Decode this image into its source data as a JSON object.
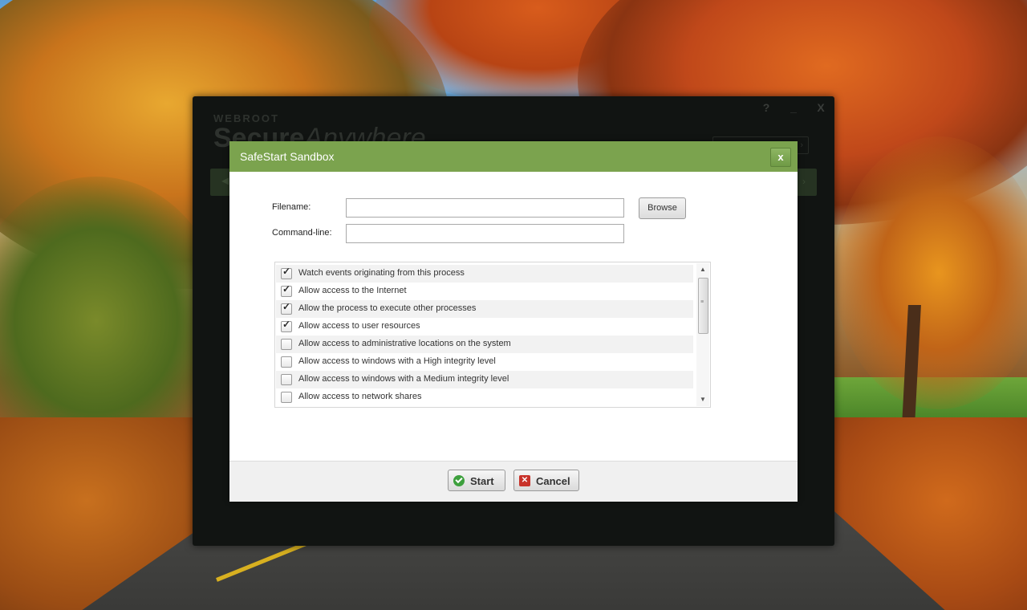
{
  "background_app": {
    "brand_small": "WEBROOT",
    "brand_bold": "Secure",
    "brand_light": "Anywhere",
    "window_controls": [
      "?",
      "_",
      "X"
    ]
  },
  "dialog": {
    "title": "SafeStart Sandbox",
    "close_label": "x",
    "filename_label": "Filename:",
    "filename_value": "",
    "commandline_label": "Command-line:",
    "commandline_value": "",
    "browse_label": "Browse",
    "options": [
      {
        "label": "Watch events originating from this process",
        "checked": true
      },
      {
        "label": "Allow access to the Internet",
        "checked": true
      },
      {
        "label": "Allow the process to execute other processes",
        "checked": true
      },
      {
        "label": "Allow access to user resources",
        "checked": true
      },
      {
        "label": "Allow access to administrative locations on the system",
        "checked": false
      },
      {
        "label": "Allow access to windows with a High integrity level",
        "checked": false
      },
      {
        "label": "Allow access to windows with a Medium integrity level",
        "checked": false
      },
      {
        "label": "Allow access to network shares",
        "checked": false
      }
    ],
    "start_label": "Start",
    "cancel_label": "Cancel"
  },
  "colors": {
    "titlebar": "#7ba34e",
    "app_window": "#111412",
    "start_icon": "#3da03d",
    "cancel_icon": "#c8322a"
  },
  "icons": {
    "close": "close-icon",
    "start": "check-circle-icon",
    "cancel": "cancel-x-icon",
    "scroll_up": "arrow-up-icon",
    "scroll_down": "arrow-down-icon",
    "checkmark": "checkmark-icon"
  }
}
